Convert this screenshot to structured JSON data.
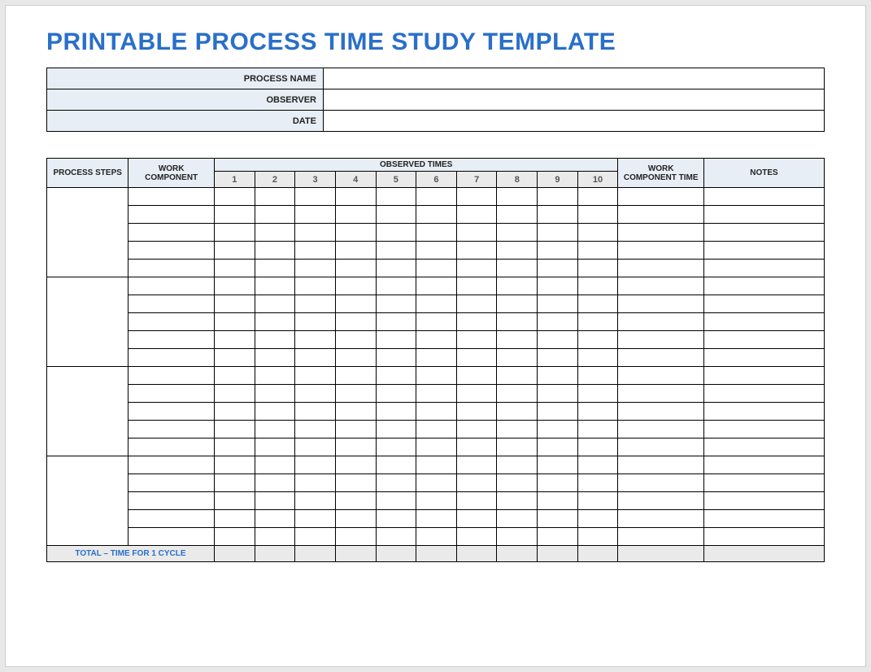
{
  "title": "PRINTABLE PROCESS TIME STUDY TEMPLATE",
  "meta": {
    "process_name_label": "PROCESS NAME",
    "process_name_value": "",
    "observer_label": "OBSERVER",
    "observer_value": "",
    "date_label": "DATE",
    "date_value": ""
  },
  "columns": {
    "process_steps": "PROCESS STEPS",
    "work_component": "WORK COMPONENT",
    "observed_times": "OBSERVED TIMES",
    "obs": [
      "1",
      "2",
      "3",
      "4",
      "5",
      "6",
      "7",
      "8",
      "9",
      "10"
    ],
    "work_component_time": "WORK COMPONENT TIME",
    "notes": "NOTES"
  },
  "groups": [
    {
      "step": "",
      "rows": [
        {
          "work": "",
          "obs": [
            "",
            "",
            "",
            "",
            "",
            "",
            "",
            "",
            "",
            ""
          ],
          "wct": "",
          "notes": ""
        },
        {
          "work": "",
          "obs": [
            "",
            "",
            "",
            "",
            "",
            "",
            "",
            "",
            "",
            ""
          ],
          "wct": "",
          "notes": ""
        },
        {
          "work": "",
          "obs": [
            "",
            "",
            "",
            "",
            "",
            "",
            "",
            "",
            "",
            ""
          ],
          "wct": "",
          "notes": ""
        },
        {
          "work": "",
          "obs": [
            "",
            "",
            "",
            "",
            "",
            "",
            "",
            "",
            "",
            ""
          ],
          "wct": "",
          "notes": ""
        },
        {
          "work": "",
          "obs": [
            "",
            "",
            "",
            "",
            "",
            "",
            "",
            "",
            "",
            ""
          ],
          "wct": "",
          "notes": ""
        }
      ]
    },
    {
      "step": "",
      "rows": [
        {
          "work": "",
          "obs": [
            "",
            "",
            "",
            "",
            "",
            "",
            "",
            "",
            "",
            ""
          ],
          "wct": "",
          "notes": ""
        },
        {
          "work": "",
          "obs": [
            "",
            "",
            "",
            "",
            "",
            "",
            "",
            "",
            "",
            ""
          ],
          "wct": "",
          "notes": ""
        },
        {
          "work": "",
          "obs": [
            "",
            "",
            "",
            "",
            "",
            "",
            "",
            "",
            "",
            ""
          ],
          "wct": "",
          "notes": ""
        },
        {
          "work": "",
          "obs": [
            "",
            "",
            "",
            "",
            "",
            "",
            "",
            "",
            "",
            ""
          ],
          "wct": "",
          "notes": ""
        },
        {
          "work": "",
          "obs": [
            "",
            "",
            "",
            "",
            "",
            "",
            "",
            "",
            "",
            ""
          ],
          "wct": "",
          "notes": ""
        }
      ]
    },
    {
      "step": "",
      "rows": [
        {
          "work": "",
          "obs": [
            "",
            "",
            "",
            "",
            "",
            "",
            "",
            "",
            "",
            ""
          ],
          "wct": "",
          "notes": ""
        },
        {
          "work": "",
          "obs": [
            "",
            "",
            "",
            "",
            "",
            "",
            "",
            "",
            "",
            ""
          ],
          "wct": "",
          "notes": ""
        },
        {
          "work": "",
          "obs": [
            "",
            "",
            "",
            "",
            "",
            "",
            "",
            "",
            "",
            ""
          ],
          "wct": "",
          "notes": ""
        },
        {
          "work": "",
          "obs": [
            "",
            "",
            "",
            "",
            "",
            "",
            "",
            "",
            "",
            ""
          ],
          "wct": "",
          "notes": ""
        },
        {
          "work": "",
          "obs": [
            "",
            "",
            "",
            "",
            "",
            "",
            "",
            "",
            "",
            ""
          ],
          "wct": "",
          "notes": ""
        }
      ]
    },
    {
      "step": "",
      "rows": [
        {
          "work": "",
          "obs": [
            "",
            "",
            "",
            "",
            "",
            "",
            "",
            "",
            "",
            ""
          ],
          "wct": "",
          "notes": ""
        },
        {
          "work": "",
          "obs": [
            "",
            "",
            "",
            "",
            "",
            "",
            "",
            "",
            "",
            ""
          ],
          "wct": "",
          "notes": ""
        },
        {
          "work": "",
          "obs": [
            "",
            "",
            "",
            "",
            "",
            "",
            "",
            "",
            "",
            ""
          ],
          "wct": "",
          "notes": ""
        },
        {
          "work": "",
          "obs": [
            "",
            "",
            "",
            "",
            "",
            "",
            "",
            "",
            "",
            ""
          ],
          "wct": "",
          "notes": ""
        },
        {
          "work": "",
          "obs": [
            "",
            "",
            "",
            "",
            "",
            "",
            "",
            "",
            "",
            ""
          ],
          "wct": "",
          "notes": ""
        }
      ]
    }
  ],
  "total": {
    "label": "TOTAL – TIME FOR 1 CYCLE",
    "obs": [
      "",
      "",
      "",
      "",
      "",
      "",
      "",
      "",
      "",
      ""
    ],
    "wct": "",
    "notes": ""
  }
}
